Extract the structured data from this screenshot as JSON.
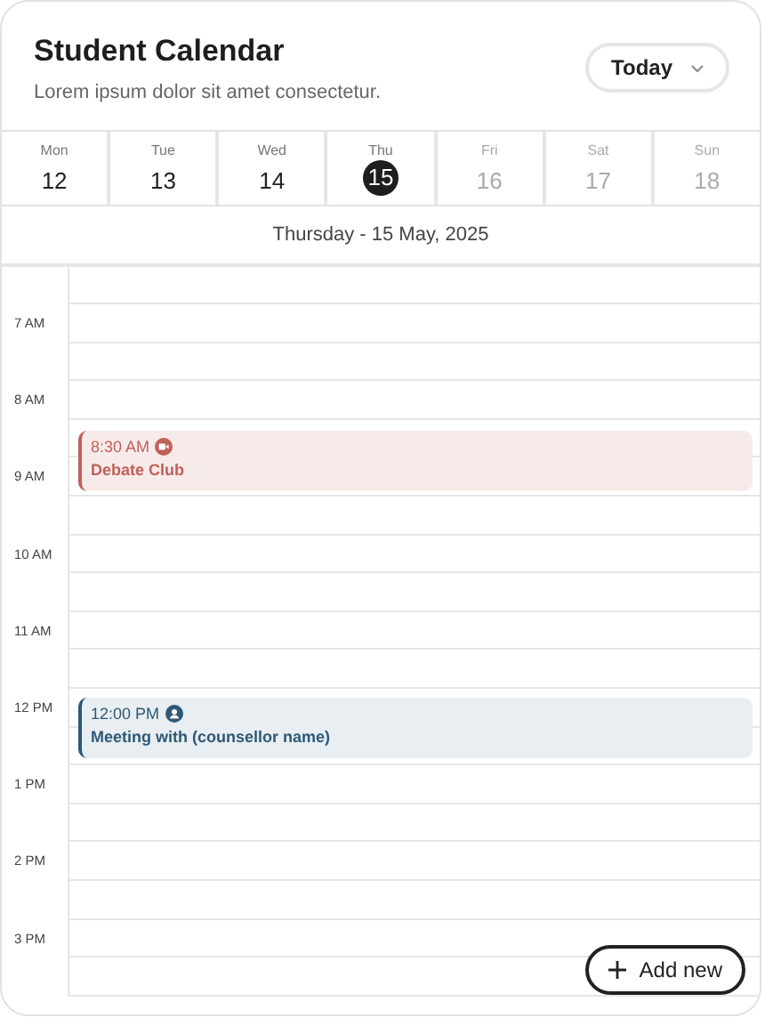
{
  "header": {
    "title": "Student Calendar",
    "subtitle": "Lorem ipsum dolor sit amet consectetur.",
    "view_button": "Today"
  },
  "week": [
    {
      "day": "Mon",
      "date": "12",
      "selected": false,
      "dimmed": false
    },
    {
      "day": "Tue",
      "date": "13",
      "selected": false,
      "dimmed": false
    },
    {
      "day": "Wed",
      "date": "14",
      "selected": false,
      "dimmed": false
    },
    {
      "day": "Thu",
      "date": "15",
      "selected": true,
      "dimmed": false
    },
    {
      "day": "Fri",
      "date": "16",
      "selected": false,
      "dimmed": true
    },
    {
      "day": "Sat",
      "date": "17",
      "selected": false,
      "dimmed": true
    },
    {
      "day": "Sun",
      "date": "18",
      "selected": false,
      "dimmed": true
    }
  ],
  "date_title": "Thursday - 15 May, 2025",
  "hours": [
    {
      "label": "7 AM"
    },
    {
      "label": "8 AM",
      "second_half": {
        "kind": "video",
        "time": "8:30 AM",
        "title": "Debate Club",
        "color": "#c0605a"
      }
    },
    {
      "label": "9 AM"
    },
    {
      "label": "10 AM"
    },
    {
      "label": "11 AM"
    },
    {
      "label": "12 PM",
      "first_half": {
        "kind": "person",
        "time": "12:00 PM",
        "title": "Meeting with (counsellor name)",
        "color": "#2f5877"
      }
    },
    {
      "label": "1 PM"
    },
    {
      "label": "2 PM"
    },
    {
      "label": "3 PM"
    }
  ],
  "add_button": "Add new"
}
